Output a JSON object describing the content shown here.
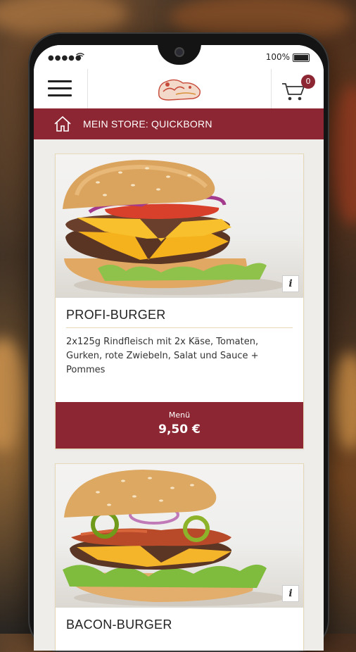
{
  "status_bar": {
    "signal": "●●●●●",
    "battery": "100%"
  },
  "app_bar": {
    "cart_count": "0"
  },
  "store_bar": {
    "label": "MEIN STORE: QUICKBORN"
  },
  "products": [
    {
      "name": "PROFI-BURGER",
      "description": "2x125g Rindfleisch mit 2x Käse, Tomaten, Gurken, rote Zwiebeln, Salat und Sauce + Pommes",
      "price_label": "Menü",
      "price": "9,50 €",
      "info": "i"
    },
    {
      "name": "BACON-BURGER",
      "info": "i"
    }
  ],
  "colors": {
    "brand": "#8c2632",
    "card_border": "#e6d9b8"
  }
}
